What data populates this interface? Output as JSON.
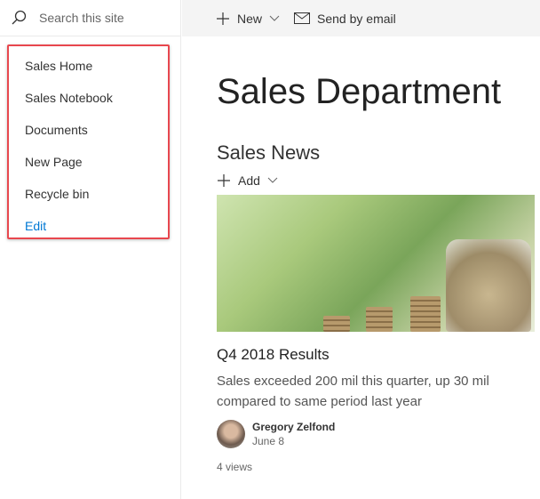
{
  "search": {
    "placeholder": "Search this site"
  },
  "nav": {
    "items": [
      "Sales Home",
      "Sales Notebook",
      "Documents",
      "New Page",
      "Recycle bin"
    ],
    "edit": "Edit"
  },
  "commandbar": {
    "new": "New",
    "send": "Send by email"
  },
  "page": {
    "title": "Sales Department"
  },
  "news": {
    "heading": "Sales News",
    "add": "Add",
    "item": {
      "title": "Q4 2018 Results",
      "description": "Sales exceeded 200 mil this quarter, up 30 mil compared to same period last year",
      "author": "Gregory Zelfond",
      "date": "June 8",
      "views": "4 views"
    }
  },
  "colors": {
    "highlight": "#e8474e",
    "link": "#0078d4"
  }
}
